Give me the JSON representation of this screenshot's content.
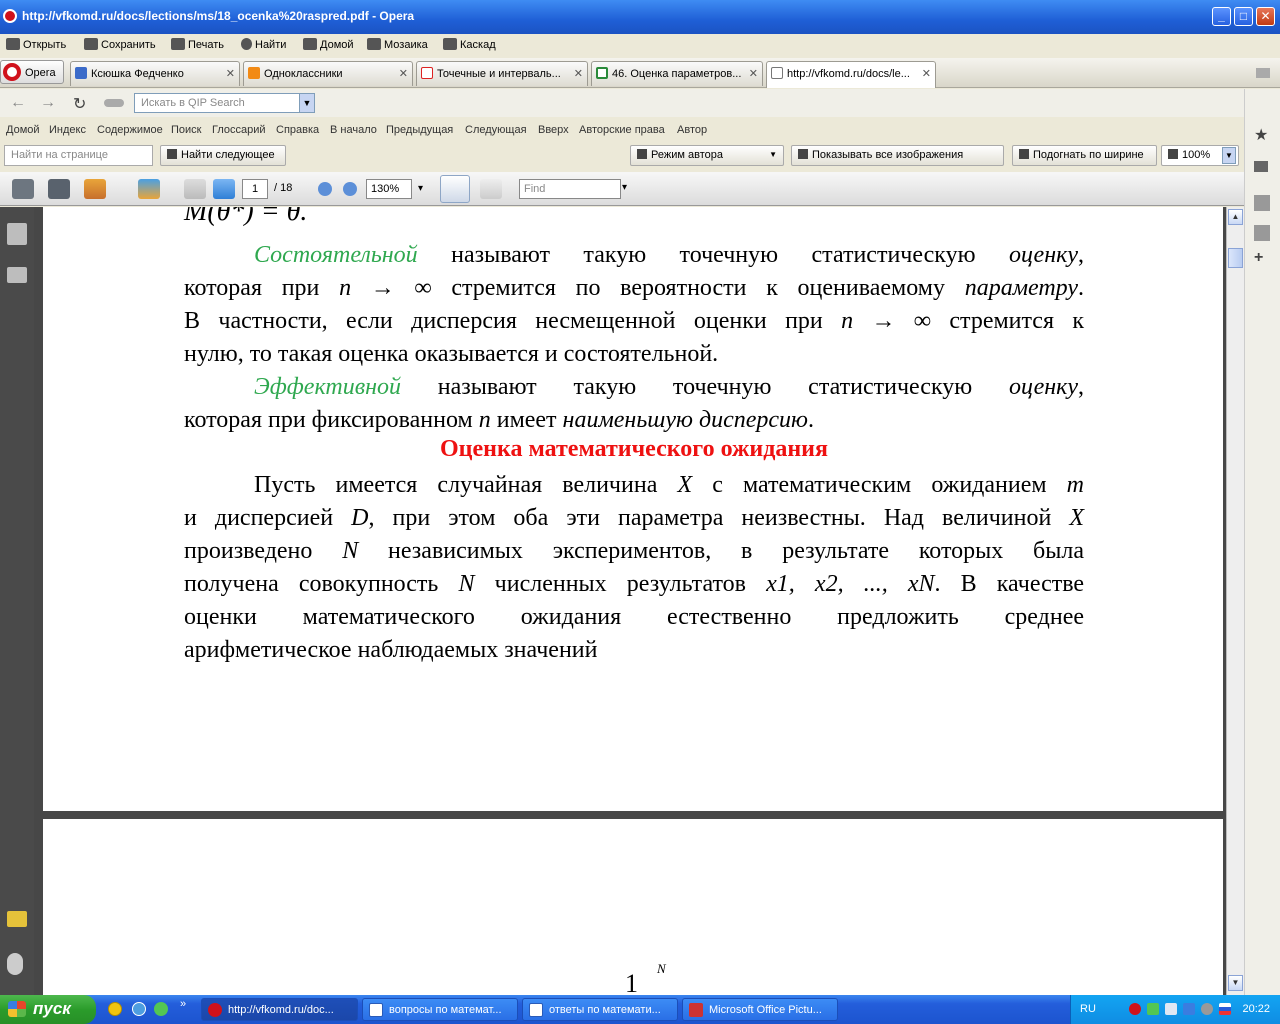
{
  "window": {
    "title": "http://vfkomd.ru/docs/lections/ms/18_ocenka%20raspred.pdf - Opera",
    "minimize": "_",
    "maximize": "□",
    "close": "✕"
  },
  "menubar": {
    "items": [
      "Открыть",
      "Сохранить",
      "Печать",
      "Найти",
      "Домой",
      "Мозаика",
      "Каскад"
    ]
  },
  "tabs": {
    "opera_label": "Opera",
    "items": [
      {
        "label": "Ксюшка Федченко",
        "close": "✕"
      },
      {
        "label": "Одноклассники",
        "close": "✕"
      },
      {
        "label": "Точечные и интерваль...",
        "close": "✕"
      },
      {
        "label": "46. Оценка параметров...",
        "close": "✕"
      },
      {
        "label": "http://vfkomd.ru/docs/le...",
        "close": "✕"
      }
    ]
  },
  "addressbar": {
    "back": "←",
    "forward": "→",
    "reload": "↻",
    "search_placeholder": "Искать в QIP Search",
    "search_dropdown": "▼"
  },
  "links": {
    "items": [
      "Домой",
      "Индекс",
      "Содержимое",
      "Поиск",
      "Глоссарий",
      "Справка",
      "В начало",
      "Предыдущая",
      "Следующая",
      "Вверх",
      "Авторские права",
      "Автор"
    ]
  },
  "findbar": {
    "find_placeholder": "Найти на странице",
    "find_next": "Найти следующее",
    "mode": "Режим автора",
    "mode_arrow": "▼",
    "show_images": "Показывать все изображения",
    "fit_width": "Подогнать по ширине",
    "zoom": "100%",
    "zoom_arrow": "▼"
  },
  "pdf_toolbar": {
    "page_current": "1",
    "page_total": "/ 18",
    "zoom": "130%",
    "zoom_arrow": "▾",
    "find_placeholder": "Find",
    "find_arrow": "▾"
  },
  "document": {
    "top_formula": "M(θ*) = θ.",
    "p1": {
      "term": "Состоятельной",
      "line1_rest": "называют такую точечную статистическую",
      "line1_it": "оценку",
      "line1_end": ",",
      "line2_a": "которая при",
      "line2_n": "n → ∞",
      "line2_b": "стремится по вероятности к оцениваемому",
      "line2_it": "параметру",
      "line2_end": ".",
      "line3_a": "В частности, если дисперсия несмещенной оценки при",
      "line3_n": "n → ∞",
      "line3_b": "стремится к",
      "line4": "нулю, то такая оценка оказывается и состоятельной."
    },
    "p2": {
      "term": "Эффективной",
      "line1_rest": "называют такую точечную статистическую",
      "line1_it": "оценку",
      "line1_end": ",",
      "line2_a": "которая при фиксированном",
      "line2_n": "n",
      "line2_b": "имеет",
      "line2_it": "наименьшую дисперсию",
      "line2_end": "."
    },
    "heading": "Оценка математического ожидания",
    "p3": {
      "line1_a": "Пусть имеется случайная величина",
      "line1_x": "X",
      "line1_b": "с математическим ожиданием",
      "line1_m": "m",
      "line2_a": "и дисперсией",
      "line2_d": "D",
      "line2_b": ", при этом оба эти параметра неизвестны. Над величиной",
      "line2_x": "X",
      "line3_a": "произведено",
      "line3_n": "N",
      "line3_b": "независимых экспериментов, в результате которых была",
      "line4_a": "получена совокупность",
      "line4_n": "N",
      "line4_b": "численных результатов",
      "line4_vars": "x1, x2, ..., xN",
      "line4_c": ". В качестве",
      "line5": "оценки математического ожидания естественно предложить среднее",
      "line6": "арифметическое наблюдаемых значений"
    },
    "page2_formula_top": "N",
    "page2_formula": "1"
  },
  "taskbar": {
    "start": "пуск",
    "tasks": [
      "http://vfkomd.ru/doc...",
      "вопросы по математ...",
      "ответы по математи...",
      "Microsoft Office Pictu..."
    ],
    "lang": "RU",
    "clock": "20:22"
  },
  "colors": {
    "term_green": "#2fa84f",
    "heading_red": "#e11111",
    "taskbar_blue": "#245edb"
  }
}
